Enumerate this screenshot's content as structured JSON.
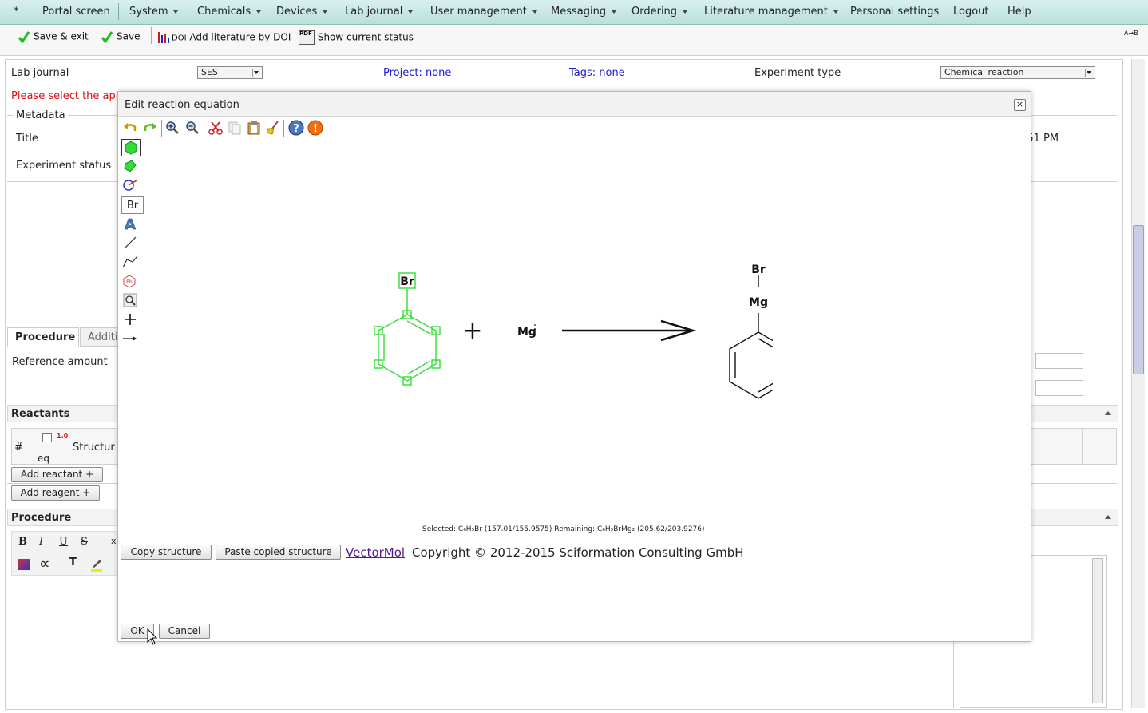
{
  "menu": {
    "items": [
      {
        "label": "*",
        "caret": false
      },
      {
        "label": "Portal screen",
        "caret": false
      },
      {
        "label": "System",
        "caret": true
      },
      {
        "label": "Chemicals",
        "caret": true
      },
      {
        "label": "Devices",
        "caret": true
      },
      {
        "label": "Lab journal",
        "caret": true
      },
      {
        "label": "User management",
        "caret": true
      },
      {
        "label": "Messaging",
        "caret": true
      },
      {
        "label": "Ordering",
        "caret": true
      },
      {
        "label": "Literature management",
        "caret": true
      },
      {
        "label": "Personal settings",
        "caret": false
      },
      {
        "label": "Logout",
        "caret": false
      },
      {
        "label": "Help",
        "caret": false
      }
    ]
  },
  "toolbar": {
    "save_exit": "Save & exit",
    "save": "Save",
    "doi_prefix": "DOI",
    "add_literature": "Add literature by DOI",
    "pdf_prefix": "PDF",
    "show_status": "Show current status",
    "corner_text": "A→B"
  },
  "form": {
    "lab_journal_label": "Lab journal",
    "lab_journal_value": "SES",
    "project_link": "Project: none",
    "tags_link": "Tags: none",
    "experiment_type_label": "Experiment type",
    "experiment_type_value": "Chemical reaction",
    "warning": "Please select the appropriate template from the list of experiment types and save then the dataset.",
    "metadata_legend": "Metadata",
    "title_label": "Title",
    "experiment_status_label": "Experiment status",
    "time_fragment": ":51 PM",
    "tab_procedure": "Procedure",
    "tab_additional": "Additio",
    "reference_amount_label": "Reference amount",
    "reactants_header": "Reactants",
    "col_hash": "#",
    "col_eq": "eq",
    "col_structure": "Structur",
    "col_ratio": "1.0",
    "add_reactant": "Add reactant +",
    "add_reagent": "Add reagent +",
    "procedure_header": "Procedure"
  },
  "editor_toolbar": {
    "bold": "B",
    "italic": "I",
    "underline": "U",
    "strike": "S",
    "sub": "xₓ",
    "alpha": "∝",
    "text_color": "T"
  },
  "dialog": {
    "title": "Edit reaction equation",
    "br_tool_label": "Br",
    "reactant_atom_br": "Br",
    "plus": "+",
    "mg_label": "Mg",
    "product_br": "Br",
    "product_mg": "Mg",
    "status_selected": "Selected: C₆H₅Br (157.01/155.9575) Remaining: C₆H₅BrMg₂ (205.62/203.9276)",
    "copy_structure": "Copy structure",
    "paste_structure": "Paste copied structure",
    "vectormol_link": "VectorMol",
    "copyright": "Copyright © 2012-2015 Sciformation Consulting GmbH",
    "ok": "OK",
    "cancel": "Cancel"
  },
  "colors": {
    "menu_bg": "#c6e6e2",
    "selection_green": "#33dd33",
    "link_blue": "#1a1ad0",
    "warning_red": "#dd1111",
    "vectormol_purple": "#551a8b"
  }
}
